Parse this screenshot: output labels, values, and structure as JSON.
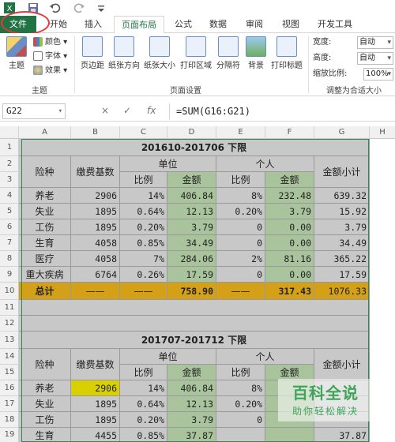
{
  "app": {
    "tabs": [
      {
        "label": "文件",
        "active": false,
        "file": true
      },
      {
        "label": "开始"
      },
      {
        "label": "插入"
      },
      {
        "label": "页面布局",
        "active": true
      },
      {
        "label": "公式"
      },
      {
        "label": "数据"
      },
      {
        "label": "审阅"
      },
      {
        "label": "视图"
      },
      {
        "label": "开发工具"
      }
    ],
    "colors": {
      "file_green": "#217346",
      "highlight_ring": "#e03a3a",
      "green_fill": "#a9c49c",
      "gray_fill": "#c8c8c8",
      "orange_fill": "#d4a017",
      "yellow_fill": "#d8d000"
    }
  },
  "ribbon": {
    "theme": {
      "main_label": "主题",
      "colors": "颜色",
      "fonts": "字体",
      "effects": "效果",
      "group_label": "主题"
    },
    "page_setup": {
      "buttons": [
        "页边距",
        "纸张方向",
        "纸张大小",
        "打印区域",
        "分隔符",
        "背景",
        "打印标题"
      ],
      "group_label": "页面设置"
    },
    "scale": {
      "width_label": "宽度:",
      "width_value": "自动",
      "height_label": "高度:",
      "height_value": "自动",
      "scale_label": "缩放比例:",
      "scale_value": "100%",
      "group_label": "调整为合适大小"
    }
  },
  "formula_bar": {
    "name_box": "G22",
    "cancel_icon": "×",
    "enter_icon": "✓",
    "fx_label": "fx",
    "formula": "=SUM(G16:G21)"
  },
  "grid": {
    "columns": [
      "A",
      "B",
      "C",
      "D",
      "E",
      "F",
      "G",
      "H"
    ],
    "rows": [
      "1",
      "2",
      "3",
      "4",
      "5",
      "6",
      "7",
      "8",
      "9",
      "10",
      "11",
      "12",
      "13",
      "14",
      "15",
      "16",
      "17",
      "18",
      "19"
    ]
  },
  "table1": {
    "title": "201610-201706  下限",
    "h_risk": "险种",
    "h_base": "缴费基数",
    "h_unit": "单位",
    "h_person": "个人",
    "h_subtotal": "金额小计",
    "h_ratio": "比例",
    "h_amount": "金额",
    "rows": [
      {
        "name": "养老",
        "base": "2906",
        "u_ratio": "14%",
        "u_amt": "406.84",
        "p_ratio": "8%",
        "p_amt": "232.48",
        "sub": "639.32"
      },
      {
        "name": "失业",
        "base": "1895",
        "u_ratio": "0.64%",
        "u_amt": "12.13",
        "p_ratio": "0.20%",
        "p_amt": "3.79",
        "sub": "15.92"
      },
      {
        "name": "工伤",
        "base": "1895",
        "u_ratio": "0.20%",
        "u_amt": "3.79",
        "p_ratio": "0",
        "p_amt": "0.00",
        "sub": "3.79"
      },
      {
        "name": "生育",
        "base": "4058",
        "u_ratio": "0.85%",
        "u_amt": "34.49",
        "p_ratio": "0",
        "p_amt": "0.00",
        "sub": "34.49"
      },
      {
        "name": "医疗",
        "base": "4058",
        "u_ratio": "7%",
        "u_amt": "284.06",
        "p_ratio": "2%",
        "p_amt": "81.16",
        "sub": "365.22"
      },
      {
        "name": "重大疾病",
        "base": "6764",
        "u_ratio": "0.26%",
        "u_amt": "17.59",
        "p_ratio": "0",
        "p_amt": "0.00",
        "sub": "17.59"
      }
    ],
    "total": {
      "name": "总计",
      "base": "——",
      "u_ratio": "——",
      "u_amt": "758.90",
      "p_ratio": "——",
      "p_amt": "317.43",
      "sub": "1076.33"
    }
  },
  "table2": {
    "title": "201707-201712  下限",
    "h_risk": "险种",
    "h_base": "缴费基数",
    "h_unit": "单位",
    "h_person": "个人",
    "h_subtotal": "金额小计",
    "h_ratio": "比例",
    "h_amount": "金额",
    "rows": [
      {
        "name": "养老",
        "base": "2906",
        "u_ratio": "14%",
        "u_amt": "406.84",
        "p_ratio": "8%",
        "p_amt": "",
        "sub": ""
      },
      {
        "name": "失业",
        "base": "1895",
        "u_ratio": "0.64%",
        "u_amt": "12.13",
        "p_ratio": "0.20%",
        "p_amt": "",
        "sub": ""
      },
      {
        "name": "工伤",
        "base": "1895",
        "u_ratio": "0.20%",
        "u_amt": "3.79",
        "p_ratio": "0",
        "p_amt": "",
        "sub": ""
      },
      {
        "name": "生育",
        "base": "4455",
        "u_ratio": "0.85%",
        "u_amt": "37.87",
        "p_ratio": "",
        "p_amt": "",
        "sub": "37.87"
      }
    ]
  },
  "watermark": {
    "title": "百科全说",
    "subtitle": "助你轻松解决"
  }
}
